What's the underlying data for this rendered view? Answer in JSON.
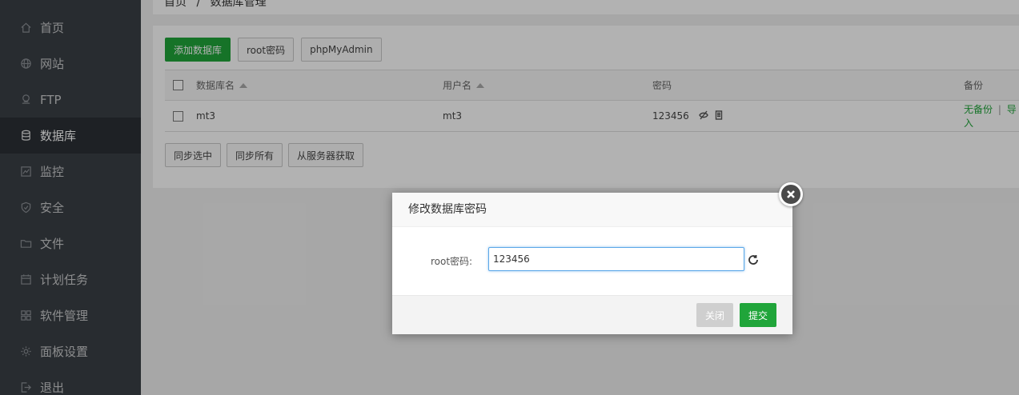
{
  "sidebar": {
    "items": [
      {
        "label": "首页",
        "icon": "home-icon"
      },
      {
        "label": "网站",
        "icon": "globe-icon"
      },
      {
        "label": "FTP",
        "icon": "ftp-icon"
      },
      {
        "label": "数据库",
        "icon": "database-icon",
        "active": true
      },
      {
        "label": "监控",
        "icon": "monitor-icon"
      },
      {
        "label": "安全",
        "icon": "shield-icon"
      },
      {
        "label": "文件",
        "icon": "folder-icon"
      },
      {
        "label": "计划任务",
        "icon": "calendar-icon"
      },
      {
        "label": "软件管理",
        "icon": "grid-icon"
      },
      {
        "label": "面板设置",
        "icon": "gear-icon"
      },
      {
        "label": "退出",
        "icon": "logout-icon"
      }
    ]
  },
  "breadcrumb": {
    "home": "首页",
    "sep": "/",
    "current": "数据库管理"
  },
  "toolbar": {
    "add_db": "添加数据库",
    "root_pw": "root密码",
    "phpmyadmin": "phpMyAdmin"
  },
  "table": {
    "headers": {
      "name": "数据库名",
      "user": "用户名",
      "password": "密码",
      "backup": "备份"
    },
    "rows": [
      {
        "name": "mt3",
        "user": "mt3",
        "password": "123456",
        "backup_none": "无备份",
        "backup_sep": "|",
        "import": "导入"
      }
    ]
  },
  "bottom_buttons": {
    "sync_selected": "同步选中",
    "sync_all": "同步所有",
    "fetch_server": "从服务器获取"
  },
  "dialog": {
    "title": "修改数据库密码",
    "label": "root密码:",
    "value": "123456",
    "close": "关闭",
    "submit": "提交"
  },
  "colors": {
    "accent": "#20a53a",
    "sidebar": "#3a3f45"
  }
}
